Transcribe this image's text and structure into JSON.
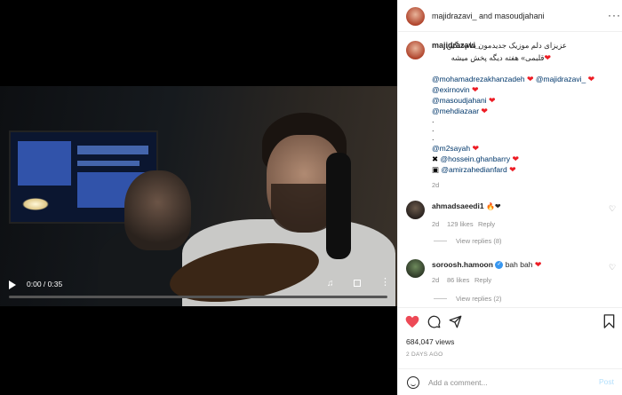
{
  "video": {
    "time": "0:00 / 0:35",
    "progress": 0
  },
  "header": {
    "title": "majidrazavi_ and masoudjahani"
  },
  "caption": {
    "username": "majidrazavi_",
    "line1": "عزیزای دلم موزیک جدیدمون بنام«نگین",
    "line2": "قلبمی» هفته دیگه پخش میشه",
    "mentions": [
      "@mohamadrezakhanzadeh",
      "@majidrazavi_",
      "@exirnovin",
      "@masoudjahani",
      "@mehdiazaar",
      "@m2sayah",
      "@hossein.ghanbarry",
      "@amirzahedianfard"
    ],
    "heart": "❤",
    "dot": ".",
    "age": "2d"
  },
  "comments": [
    {
      "username": "ahmadsaeedi1",
      "text": "🔥❤",
      "age": "2d",
      "likes": "129 likes",
      "reply": "Reply",
      "view_replies": "View replies (8)"
    },
    {
      "username": "soroosh.hamoon",
      "text": "bah bah",
      "age": "2d",
      "likes": "86 likes",
      "reply": "Reply",
      "view_replies": "View replies (2)"
    }
  ],
  "stats": {
    "views": "684,047 views",
    "posted": "2 DAYS AGO"
  },
  "add_comment": {
    "placeholder": "Add a comment...",
    "post": "Post"
  },
  "colors": {
    "like_red": "#ed4956",
    "link_blue": "#00376b",
    "verified_blue": "#3897f0"
  }
}
